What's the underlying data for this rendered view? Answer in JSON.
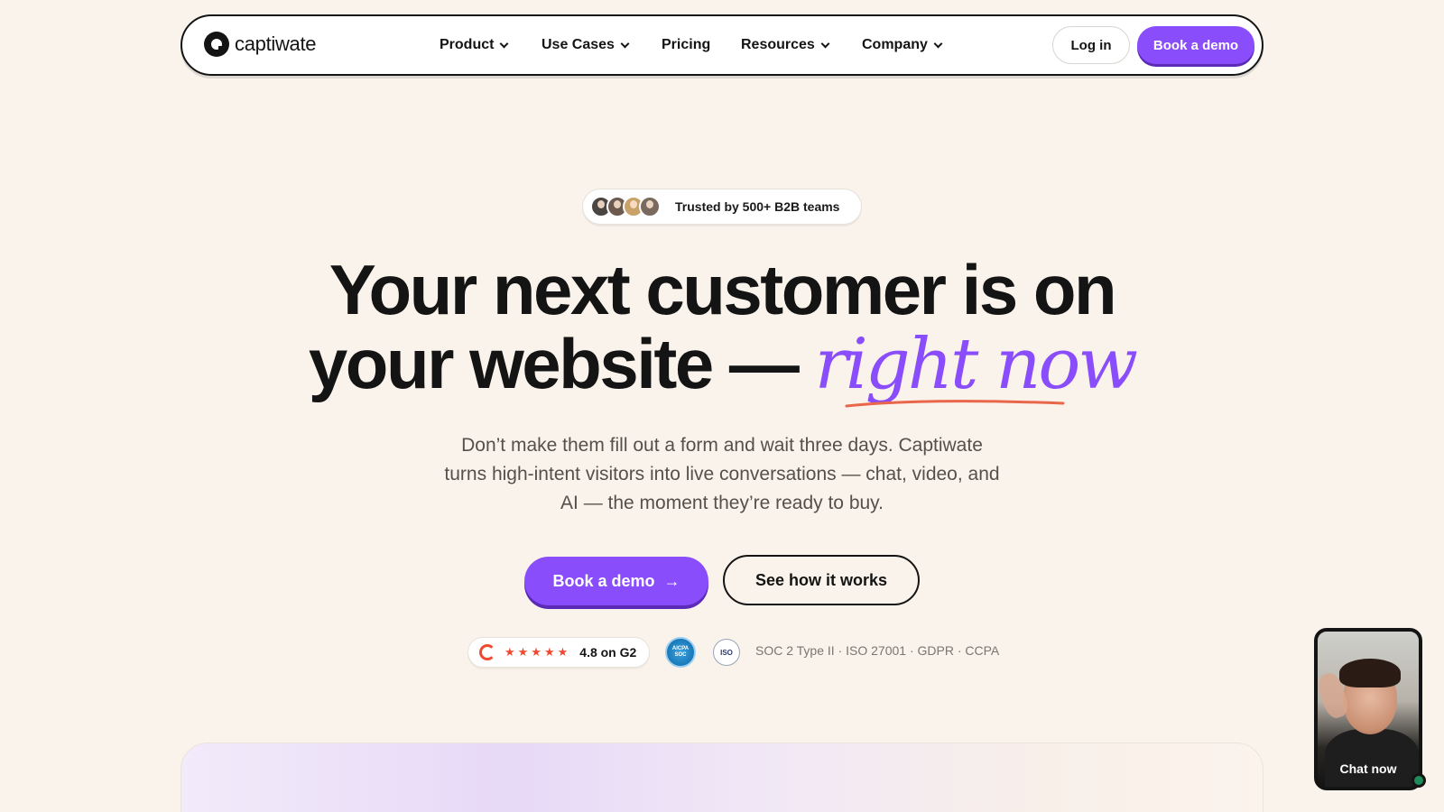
{
  "nav": {
    "brand": "captiwate",
    "menu": [
      {
        "label": "Product",
        "has_dropdown": true
      },
      {
        "label": "Use Cases",
        "has_dropdown": true
      },
      {
        "label": "Pricing",
        "has_dropdown": false
      },
      {
        "label": "Resources",
        "has_dropdown": true
      },
      {
        "label": "Company",
        "has_dropdown": true
      }
    ],
    "login_label": "Log in",
    "demo_label": "Book a demo"
  },
  "trust": {
    "text": "Trusted by 500+ B2B teams",
    "avatar_colors": [
      "#4a4541",
      "#6b5a4d",
      "#c9a26a",
      "#7a6a5e"
    ]
  },
  "hero": {
    "headline_line1": "Your next customer is on",
    "headline_line2_plain": "your website —",
    "headline_accent": "right now",
    "subtext": "Don’t make them fill out a form and wait three days. Captiwate turns high-intent visitors into live conversations — chat, video, and AI — the moment they’re ready to buy.",
    "cta_primary": "Book a demo",
    "cta_primary_arrow": "→",
    "cta_secondary": "See how it works"
  },
  "badges": {
    "g2_stars": "★★★★★",
    "g2_rating": "4.8 on G2",
    "aicpa_label": "AICPA SOC",
    "iso_label": "ISO",
    "compliance": "SOC 2 Type II · ISO 27001 · GDPR · CCPA"
  },
  "widget": {
    "label": "Chat now"
  },
  "colors": {
    "brand_purple": "#8a4dfb",
    "background": "#faf3ec",
    "accent_underline": "#e8664a",
    "text_dark": "#141414"
  }
}
